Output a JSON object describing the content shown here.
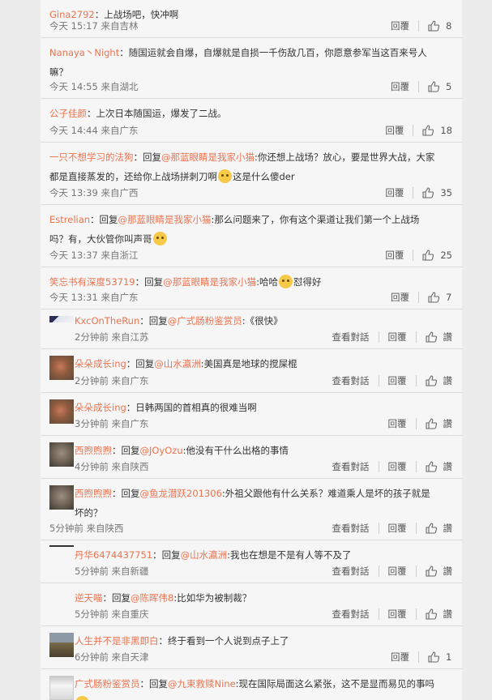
{
  "ui": {
    "reply_label": "回覆",
    "view_label": "查看對話",
    "like_text_label": "讚"
  },
  "comments": [
    {
      "user": "Gina2792",
      "segments": [
        "：上战场吧，快冲啊"
      ],
      "time": "今天 15:17",
      "loc": "来自吉林",
      "likes": "8"
    },
    {
      "user": "Nanaya丶Night",
      "segments": [
        "：随国运就会自爆，自爆就是自损一千伤敌几百，你愿意参军当这百来号人嘛？"
      ],
      "time": "今天 14:55",
      "loc": "来自湖北",
      "likes": "5"
    },
    {
      "user": "公子佳颜",
      "segments": [
        "：上次日本随国运，爆发了二战。"
      ],
      "time": "今天 14:44",
      "loc": "来自广东",
      "likes": "18"
    },
    {
      "user": "一只不想学习的法狗",
      "reply_prefix": "：回复",
      "mention": "@那蓝眼睛是我家小猫",
      "segments": [
        ":你还想上战场？放心，要是世界大战，大家都是直接蒸发的，还给你上战场拼刺刀啊",
        "这是什么傻der"
      ],
      "time": "今天 13:39",
      "loc": "来自广西",
      "likes": "35"
    },
    {
      "user": "Estrelian",
      "reply_prefix": "：回复",
      "mention": "@那蓝眼睛是我家小猫",
      "segments": [
        ":那么问题来了，你有这个渠道让我们第一个上战场吗？有，大伙管你叫声哥",
        ""
      ],
      "time": "今天 13:37",
      "loc": "来自浙江",
      "likes": "25"
    },
    {
      "user": "笑忘书有深度53719",
      "reply_prefix": "：回复",
      "mention": "@那蓝眼睛是我家小猫",
      "segments": [
        ":哈哈",
        "怼得好"
      ],
      "time": "今天 13:31",
      "loc": "来自广东",
      "likes": "7"
    },
    {
      "user": "KxcOnTheRun",
      "reply_prefix": "：回复",
      "mention": "@广式肠粉鉴赏员",
      "segments": [
        ":《很快》"
      ],
      "time": "2分钟前",
      "loc": "来自江苏",
      "likes": ""
    },
    {
      "user": "朵朵成长ing",
      "reply_prefix": "：回复",
      "mention": "@山水瀛洲",
      "segments": [
        ":美国真是地球的搅屎棍"
      ],
      "time": "2分钟前",
      "loc": "来自广东",
      "likes": ""
    },
    {
      "user": "朵朵成长ing",
      "segments": [
        "：日韩两国的首相真的很难当啊"
      ],
      "time": "3分钟前",
      "loc": "来自广东",
      "likes": ""
    },
    {
      "user": "西煦煦煦",
      "reply_prefix": "：回复",
      "mention": "@JOyOzu",
      "segments": [
        ":他没有干什么出格的事情"
      ],
      "time": "4分钟前",
      "loc": "来自陕西",
      "likes": ""
    },
    {
      "user": "西煦煦煦",
      "reply_prefix": "：回复",
      "mention": "@鱼龙潜跃201306",
      "segments": [
        ":外祖父跟他有什么关系？难道乘人是坏的孩子就是坏的？"
      ],
      "time": "5分钟前",
      "loc": "来自陕西",
      "likes": ""
    },
    {
      "user": "丹华6474437751",
      "reply_prefix": "：回复",
      "mention": "@山水瀛洲",
      "segments": [
        ":我也在想是不是有人等不及了"
      ],
      "time": "5分钟前",
      "loc": "来自新疆",
      "likes": ""
    },
    {
      "user": "逆天喵",
      "reply_prefix": "：回复",
      "mention": "@陈晖伟8",
      "segments": [
        ":比如华为被制裁？"
      ],
      "time": "5分钟前",
      "loc": "来自重庆",
      "likes": ""
    },
    {
      "user": "人生并不是非黑即白",
      "segments": [
        "：终于看到一个人说到点子上了"
      ],
      "time": "6分钟前",
      "loc": "来自天津",
      "likes": "1"
    },
    {
      "user": "广式肠粉鉴赏员",
      "reply_prefix": "：回复",
      "mention": "@九束救赎Nine",
      "segments": [
        ":现在国际局面这么紧张，这不是显而易见的事吗"
      ],
      "time": "",
      "loc": "",
      "likes": ""
    }
  ]
}
